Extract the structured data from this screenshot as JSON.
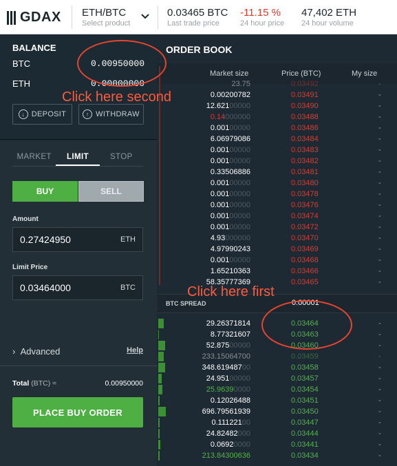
{
  "header": {
    "logo": "GDAX",
    "product": "ETH/BTC",
    "product_sub": "Select product",
    "last_trade": "0.03465 BTC",
    "last_trade_sub": "Last trade price",
    "change": "-11.15 %",
    "change_sub": "24 hour price",
    "volume": "47,402 ETH",
    "volume_sub": "24 hour volume"
  },
  "balance": {
    "title": "BALANCE",
    "btc_label": "BTC",
    "btc_value": "0.00950000",
    "eth_label": "ETH",
    "eth_value": "0.00000000",
    "deposit": "DEPOSIT",
    "withdraw": "WITHDRAW"
  },
  "order_form": {
    "tabs": [
      "MARKET",
      "LIMIT",
      "STOP"
    ],
    "buy": "BUY",
    "sell": "SELL",
    "amount_label": "Amount",
    "amount_value": "0.27424950",
    "amount_unit": "ETH",
    "limit_label": "Limit Price",
    "limit_value": "0.03464000",
    "limit_unit": "BTC",
    "advanced": "Advanced",
    "help": "Help",
    "total_label": "Total",
    "total_unit": "(BTC) ≈",
    "total_value": "0.00950000",
    "place": "PLACE BUY ORDER"
  },
  "order_book": {
    "title": "ORDER BOOK",
    "col_market_size": "Market size",
    "col_price": "Price (BTC)",
    "col_my_size": "My size",
    "asks": [
      {
        "size": "23.75",
        "dim": "",
        "price": "0.03492",
        "mine": "-",
        "partial": true
      },
      {
        "size": "0.00200782",
        "dim": "",
        "price": "0.03491",
        "mine": "-"
      },
      {
        "size": "12.621",
        "dim": "00000",
        "price": "0.03490",
        "mine": "-"
      },
      {
        "size": "0.14",
        "dim": "000000",
        "price": "0.03488",
        "mine": "-",
        "size_red": true
      },
      {
        "size": "0.001",
        "dim": "00000",
        "price": "0.03486",
        "mine": "-"
      },
      {
        "size": "6.06979086",
        "dim": "",
        "price": "0.03484",
        "mine": "-"
      },
      {
        "size": "0.001",
        "dim": "00000",
        "price": "0.03483",
        "mine": "-"
      },
      {
        "size": "0.001",
        "dim": "00000",
        "price": "0.03482",
        "mine": "-"
      },
      {
        "size": "0.33506886",
        "dim": "",
        "price": "0.03481",
        "mine": "-"
      },
      {
        "size": "0.001",
        "dim": "00000",
        "price": "0.03480",
        "mine": "-"
      },
      {
        "size": "0.001",
        "dim": "00000",
        "price": "0.03478",
        "mine": "-"
      },
      {
        "size": "0.001",
        "dim": "00000",
        "price": "0.03476",
        "mine": "-"
      },
      {
        "size": "0.001",
        "dim": "00000",
        "price": "0.03474",
        "mine": "-"
      },
      {
        "size": "0.001",
        "dim": "00000",
        "price": "0.03472",
        "mine": "-"
      },
      {
        "size": "4.93",
        "dim": "000000",
        "price": "0.03470",
        "mine": "-"
      },
      {
        "size": "4.97990243",
        "dim": "",
        "price": "0.03469",
        "mine": "-"
      },
      {
        "size": "0.001",
        "dim": "00000",
        "price": "0.03468",
        "mine": "-"
      },
      {
        "size": "1.65210363",
        "dim": "",
        "price": "0.03466",
        "mine": "-"
      },
      {
        "size": "58.35777369",
        "dim": "",
        "price": "0.03465",
        "mine": "-"
      }
    ],
    "spread_label": "BTC SPREAD",
    "spread_value": "0.00001",
    "bids": [
      {
        "size": "29.26371814",
        "dim": "",
        "price": "0.03464",
        "mine": "-"
      },
      {
        "size": "8.77321607",
        "dim": "",
        "price": "0.03463",
        "mine": "-"
      },
      {
        "size": "52.875",
        "dim": "00000",
        "price": "0.03460",
        "mine": "-"
      },
      {
        "size": "233.15064700",
        "dim": "",
        "price": "0.03459",
        "mine": "-",
        "faded": true
      },
      {
        "size": "348.619487",
        "dim": "00",
        "price": "0.03458",
        "mine": "-"
      },
      {
        "size": "24.951",
        "dim": "00000",
        "price": "0.03457",
        "mine": "-"
      },
      {
        "size": "25.9639",
        "dim": "0000",
        "price": "0.03454",
        "mine": "-",
        "size_green": true
      },
      {
        "size": "0.12026488",
        "dim": "",
        "price": "0.03451",
        "mine": "-"
      },
      {
        "size": "696.79561939",
        "dim": "",
        "price": "0.03450",
        "mine": "-"
      },
      {
        "size": "0.111221",
        "dim": "00",
        "price": "0.03447",
        "mine": "-"
      },
      {
        "size": "24.82482",
        "dim": "000",
        "price": "0.03444",
        "mine": "-"
      },
      {
        "size": "0.0692",
        "dim": "0000",
        "price": "0.03441",
        "mine": "-"
      },
      {
        "size": "213.84300636",
        "dim": "",
        "price": "0.03434",
        "mine": "-",
        "size_green": true
      }
    ],
    "bid_depth": [
      0.08,
      0.01,
      0.1,
      0.08,
      0.1,
      0.05,
      0.06,
      0.02,
      0.11,
      0.02,
      0.02,
      0.03,
      0.02
    ]
  },
  "annotations": {
    "second": "Click here second",
    "first": "Click here first"
  }
}
